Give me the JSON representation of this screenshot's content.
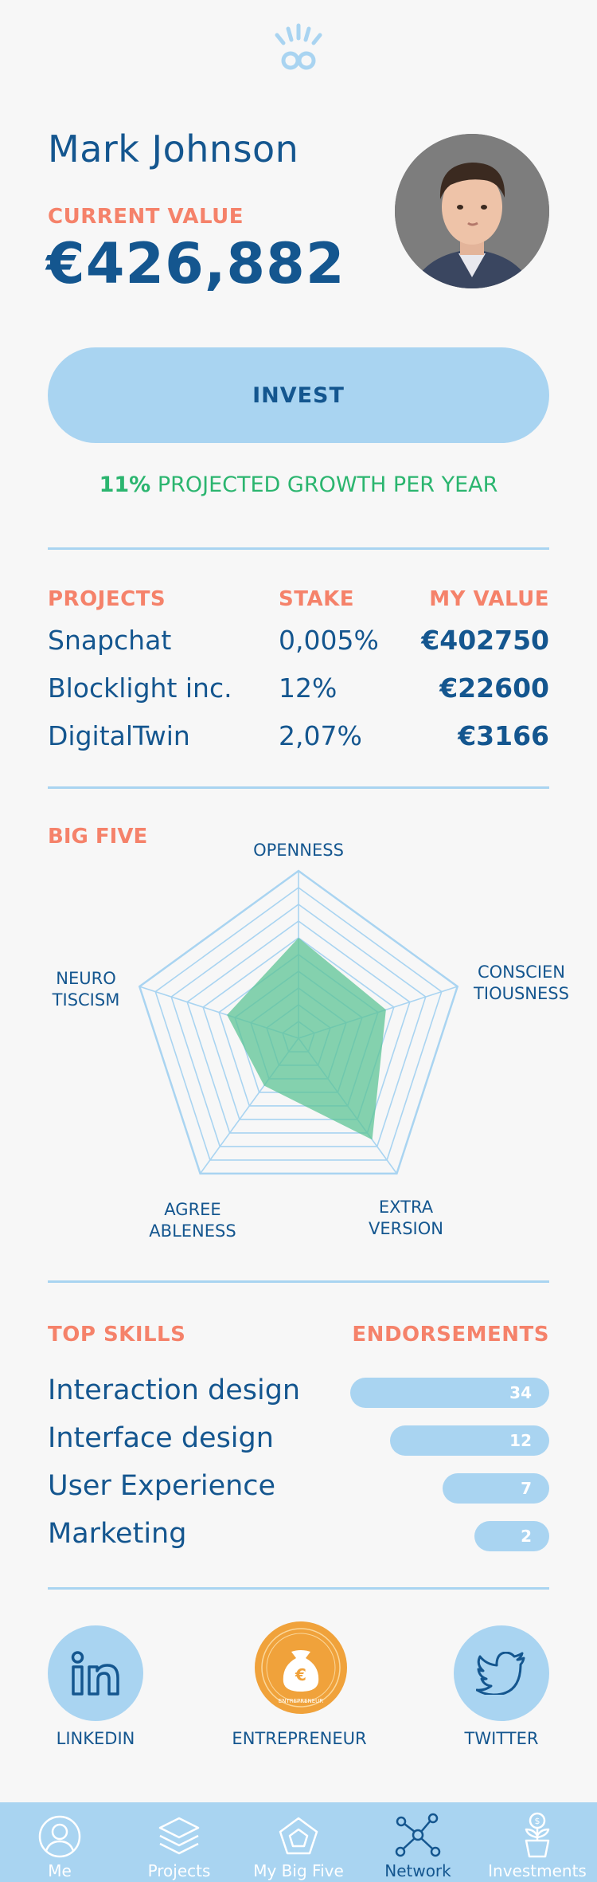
{
  "profile": {
    "name": "Mark Johnson",
    "current_value_label": "CURRENT VALUE",
    "current_value": "€426,882"
  },
  "invest": {
    "label": "INVEST"
  },
  "growth": {
    "percent": "11%",
    "text": "PROJECTED GROWTH PER YEAR"
  },
  "projects": {
    "headers": {
      "project": "PROJECTS",
      "stake": "STAKE",
      "value": "MY VALUE"
    },
    "rows": [
      {
        "name": "Snapchat",
        "stake": "0,005%",
        "value": "€402750"
      },
      {
        "name": "Blocklight inc.",
        "stake": "12%",
        "value": "€22600"
      },
      {
        "name": "DigitalTwin",
        "stake": "2,07%",
        "value": "€3166"
      }
    ]
  },
  "big_five": {
    "title": "BIG FIVE",
    "axes": {
      "openness": "OPENNESS",
      "conscientiousness_1": "CONSCIEN",
      "conscientiousness_2": "TIOUSNESS",
      "extraversion_1": "EXTRA",
      "extraversion_2": "VERSION",
      "agreeableness_1": "AGREE",
      "agreeableness_2": "ABLENESS",
      "neuroticism_1": "NEURO",
      "neuroticism_2": "TISCISM"
    },
    "scores": {
      "openness": 0.6,
      "conscientiousness": 0.55,
      "extraversion": 0.75,
      "agreeableness": 0.35,
      "neuroticism": 0.45
    },
    "fill_color": "#5ec496",
    "grid_color": "#a9d4f1"
  },
  "skills": {
    "header_skills": "TOP SKILLS",
    "header_endorsements": "ENDORSEMENTS",
    "items": [
      {
        "name": "Interaction design",
        "count": "34"
      },
      {
        "name": "Interface design",
        "count": "12"
      },
      {
        "name": "User Experience",
        "count": "7"
      },
      {
        "name": "Marketing",
        "count": "2"
      }
    ]
  },
  "social": {
    "linkedin": "LINKEDIN",
    "entrepreneur": "ENTREPRENEUR",
    "badge_text": "ENTREPRENEUR",
    "twitter": "TWITTER"
  },
  "nav": {
    "me": "Me",
    "projects": "Projects",
    "big_five": "My Big Five",
    "network": "Network",
    "investments": "Investments"
  },
  "colors": {
    "primary": "#14568f",
    "accent": "#f5826a",
    "light_blue": "#a9d4f1",
    "green": "#2bb56f",
    "badge_orange": "#f0a23b"
  }
}
